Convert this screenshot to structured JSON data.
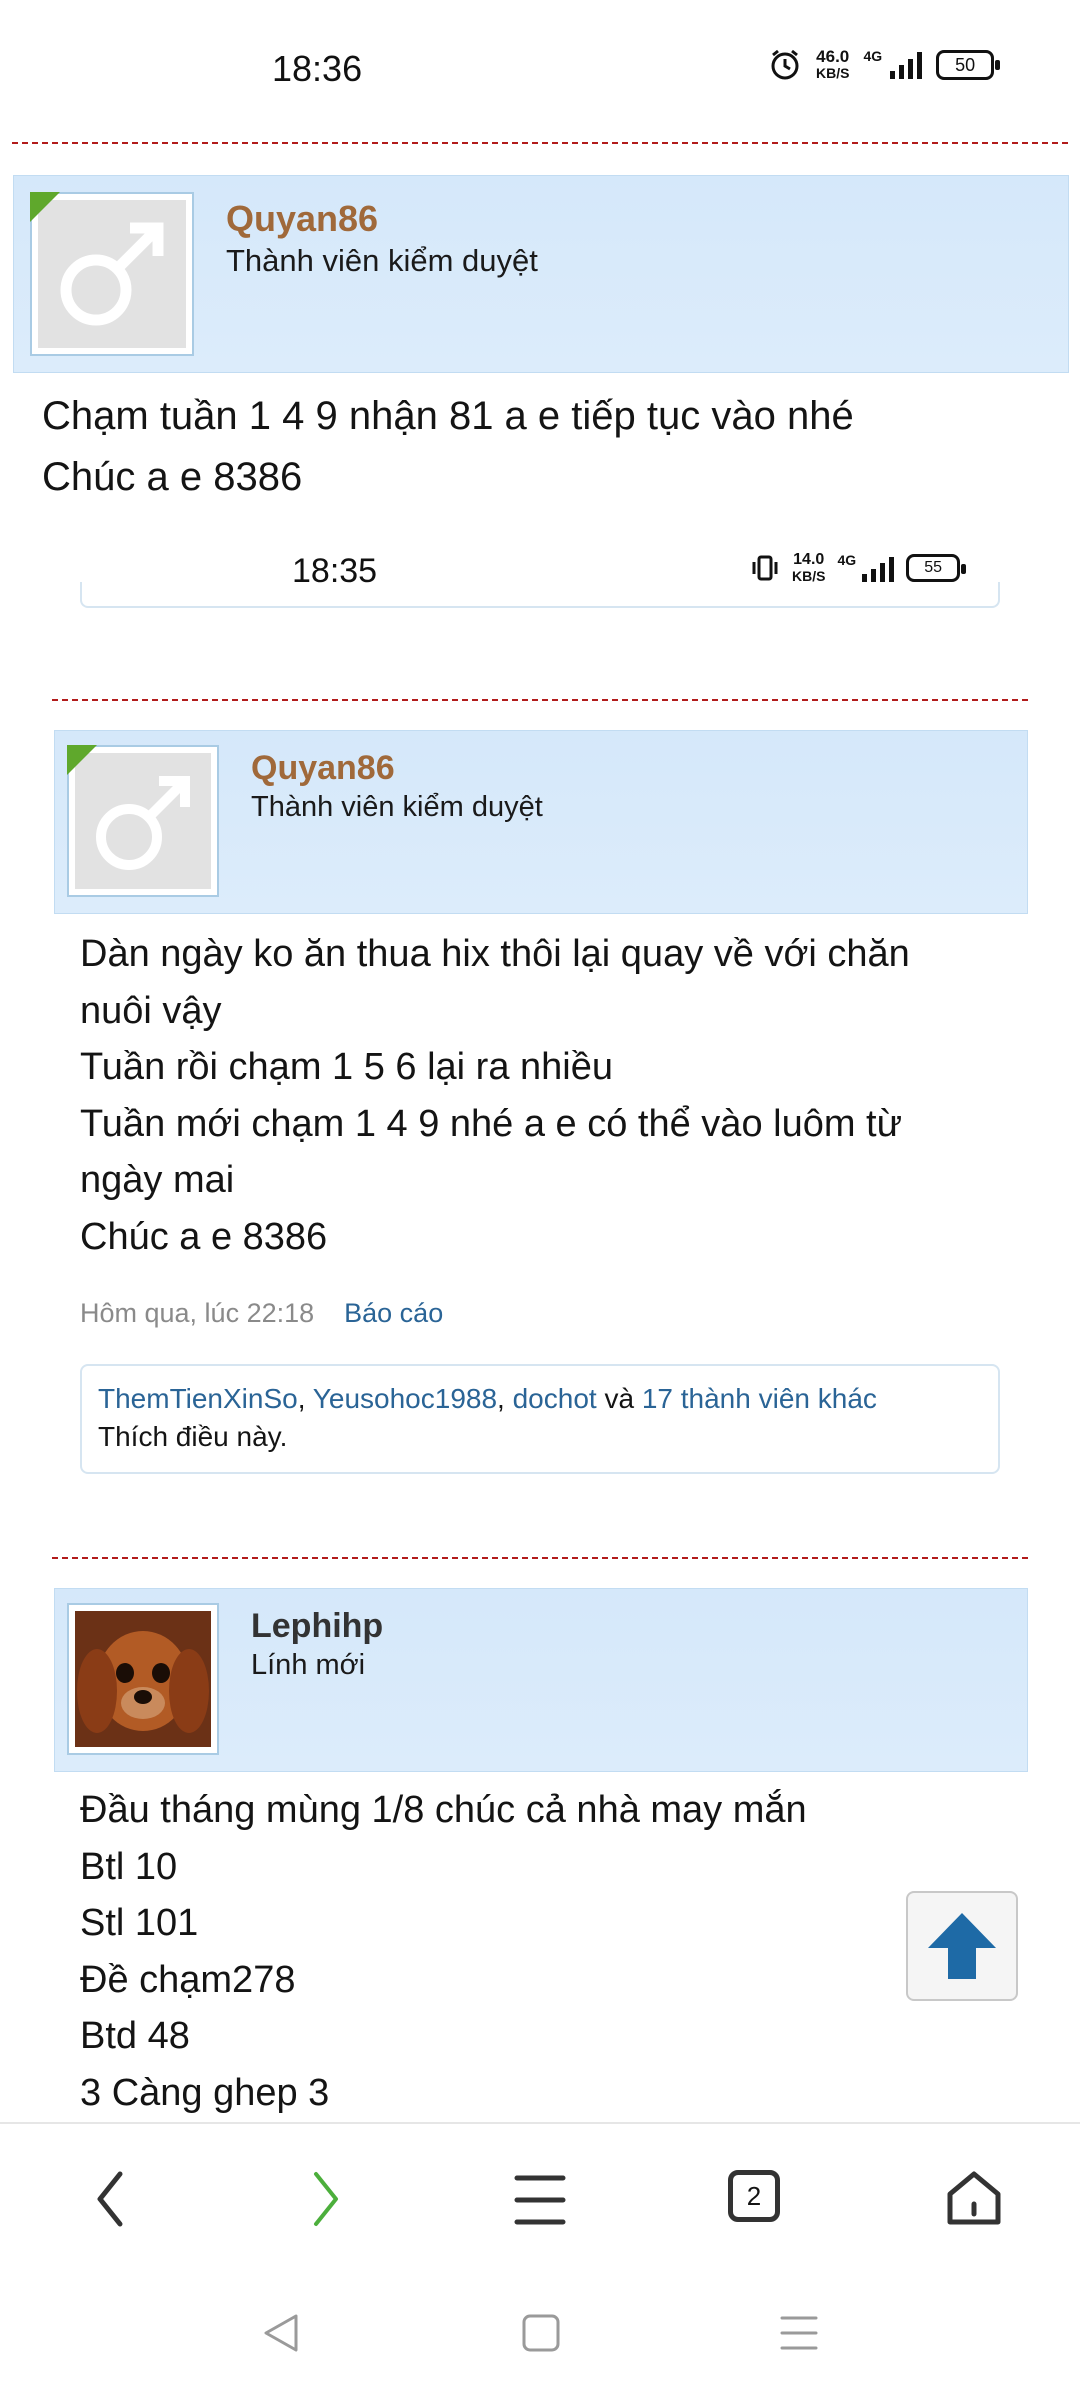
{
  "status_bar": {
    "time": "18:36",
    "speed_value": "46.0",
    "speed_unit": "KB/S",
    "network": "4G",
    "battery": "50"
  },
  "post_1": {
    "username": "Quyan86",
    "role": "Thành viên kiểm duyệt",
    "text": "Chạm tuần 1 4 9 nhận 81 a e tiếp tục vào nhé\nChúc a e 8386"
  },
  "embedded_screenshot": {
    "status_bar": {
      "time": "18:35",
      "speed_value": "14.0",
      "speed_unit": "KB/S",
      "network": "4G",
      "battery": "55"
    },
    "post": {
      "username": "Quyan86",
      "role": "Thành viên kiểm duyệt",
      "text": "Dàn ngày ko ăn thua hix thôi lại quay về với chăn\nnuôi vậy\nTuần rồi chạm 1 5 6 lại ra nhiều\nTuần mới chạm 1 4 9 nhé a e có thể vào luôm từ\nngày mai\nChúc a e 8386",
      "timestamp": "Hôm qua, lúc 22:18",
      "report_label": "Báo cáo",
      "likes": {
        "users": [
          "ThemTienXinSo",
          "Yeusohoc1988",
          "dochot"
        ],
        "separator": ", ",
        "and_word": " và ",
        "others": "17 thành viên khác",
        "suffix": "Thích điều này."
      }
    },
    "post_next": {
      "username": "Lephihp",
      "role": "Lính mới",
      "text": "Đầu tháng mùng 1/8 chúc cả nhà may mắn\nBtl 10\nStl 101\nĐề chạm278\nBtd 48\n3 Càng ghep 3"
    }
  },
  "bottom_nav": {
    "tab_count": "2"
  },
  "icons": [
    "alarm-icon",
    "vibrate-icon",
    "signal-icon",
    "battery-icon",
    "male-symbol-icon",
    "scroll-top-arrow-icon",
    "back-icon",
    "forward-icon",
    "menu-icon",
    "tabs-icon",
    "home-icon",
    "system-back-icon",
    "system-home-icon",
    "system-recents-icon"
  ],
  "colors": {
    "username": "#a0693a",
    "link": "#2a6496",
    "divider": "#b21b1b",
    "user_block": "#d5e8fa",
    "scroll_arrow": "#1e6aa6",
    "forward_active": "#4caf3c"
  }
}
